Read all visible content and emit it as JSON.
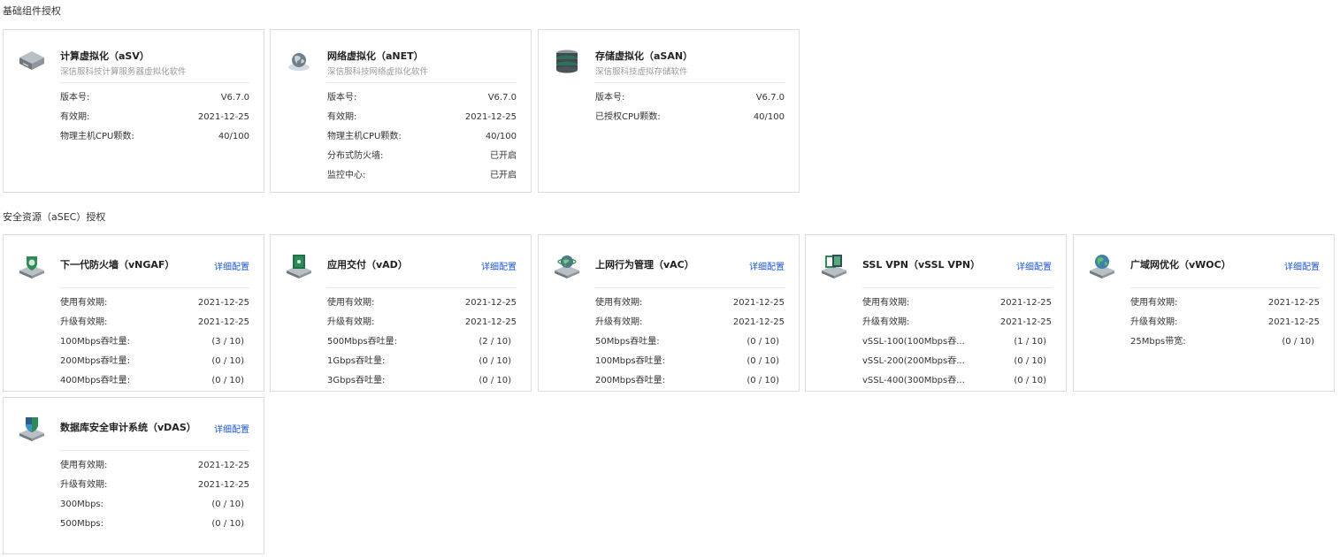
{
  "sections": {
    "basic_title": "基础组件授权",
    "security_title": "安全资源（aSEC）授权"
  },
  "basic_cards": [
    {
      "title": "计算虚拟化（aSV）",
      "desc": "深信服科技计算服务器虚拟化软件",
      "icon": "server-icon",
      "rows": [
        {
          "k": "版本号:",
          "v": "V6.7.0"
        },
        {
          "k": "有效期:",
          "v": "2021-12-25"
        },
        {
          "k": "物理主机CPU颗数:",
          "v": "40/100"
        }
      ]
    },
    {
      "title": "网络虚拟化（aNET）",
      "desc": "深信服科技网络虚拟化软件",
      "icon": "globe-icon",
      "rows": [
        {
          "k": "版本号:",
          "v": "V6.7.0"
        },
        {
          "k": "有效期:",
          "v": "2021-12-25"
        },
        {
          "k": "物理主机CPU颗数:",
          "v": "40/100"
        },
        {
          "k": "分布式防火墙:",
          "v": "已开启"
        },
        {
          "k": "监控中心:",
          "v": "已开启"
        }
      ]
    },
    {
      "title": "存储虚拟化（aSAN）",
      "desc": "深信服科技虚拟存储软件",
      "icon": "database-icon",
      "rows": [
        {
          "k": "版本号:",
          "v": "V6.7.0"
        },
        {
          "k": "已授权CPU颗数:",
          "v": "40/100"
        }
      ]
    }
  ],
  "security_cards": [
    {
      "title": "下一代防火墙（vNGAF）",
      "link": "详细配置",
      "icon": "firewall-icon",
      "rows": [
        {
          "k": "使用有效期:",
          "v": "2021-12-25"
        },
        {
          "k": "升级有效期:",
          "v": "2021-12-25"
        },
        {
          "k": "100Mbps吞吐量:",
          "v": "(3 / 10)"
        },
        {
          "k": "200Mbps吞吐量:",
          "v": "(0 / 10)"
        },
        {
          "k": "400Mbps吞吐量:",
          "v": "(0 / 10)"
        }
      ]
    },
    {
      "title": "应用交付（vAD）",
      "link": "详细配置",
      "icon": "app-delivery-icon",
      "rows": [
        {
          "k": "使用有效期:",
          "v": "2021-12-25"
        },
        {
          "k": "升级有效期:",
          "v": "2021-12-25"
        },
        {
          "k": "500Mbps吞吐量:",
          "v": "(2 / 10)"
        },
        {
          "k": "1Gbps吞吐量:",
          "v": "(0 / 10)"
        },
        {
          "k": "3Gbps吞吐量:",
          "v": "(0 / 10)"
        }
      ]
    },
    {
      "title": "上网行为管理（vAC）",
      "link": "详细配置",
      "icon": "behavior-management-icon",
      "rows": [
        {
          "k": "使用有效期:",
          "v": "2021-12-25"
        },
        {
          "k": "升级有效期:",
          "v": "2021-12-25"
        },
        {
          "k": "50Mbps吞吐量:",
          "v": "(0 / 10)"
        },
        {
          "k": "100Mbps吞吐量:",
          "v": "(0 / 10)"
        },
        {
          "k": "200Mbps吞吐量:",
          "v": "(0 / 10)"
        }
      ]
    },
    {
      "title": "SSL VPN（vSSL VPN）",
      "link": "详细配置",
      "icon": "vpn-icon",
      "rows": [
        {
          "k": "使用有效期:",
          "v": "2021-12-25"
        },
        {
          "k": "升级有效期:",
          "v": "2021-12-25"
        },
        {
          "k": "vSSL-100(100Mbps吞...",
          "v": "(1 / 10)"
        },
        {
          "k": "vSSL-200(200Mbps吞...",
          "v": "(0 / 10)"
        },
        {
          "k": "vSSL-400(300Mbps吞...",
          "v": "(0 / 10)"
        }
      ]
    },
    {
      "title": "广域网优化（vWOC）",
      "link": "详细配置",
      "icon": "wan-optimization-icon",
      "rows": [
        {
          "k": "使用有效期:",
          "v": "2021-12-25"
        },
        {
          "k": "升级有效期:",
          "v": "2021-12-25"
        },
        {
          "k": "25Mbps带宽:",
          "v": "(0 / 10)"
        }
      ]
    },
    {
      "title": "数据库安全审计系统（vDAS）",
      "link": "详细配置",
      "icon": "database-audit-icon",
      "rows": [
        {
          "k": "使用有效期:",
          "v": "2021-12-25"
        },
        {
          "k": "升级有效期:",
          "v": "2021-12-25"
        },
        {
          "k": "300Mbps:",
          "v": "(0 / 10)"
        },
        {
          "k": "500Mbps:",
          "v": "(0 / 10)"
        }
      ]
    }
  ],
  "colors": {
    "link": "#1f57d6",
    "border": "#dcdcdc",
    "icon_base": "#8a9299",
    "icon_green": "#2e8b57"
  }
}
